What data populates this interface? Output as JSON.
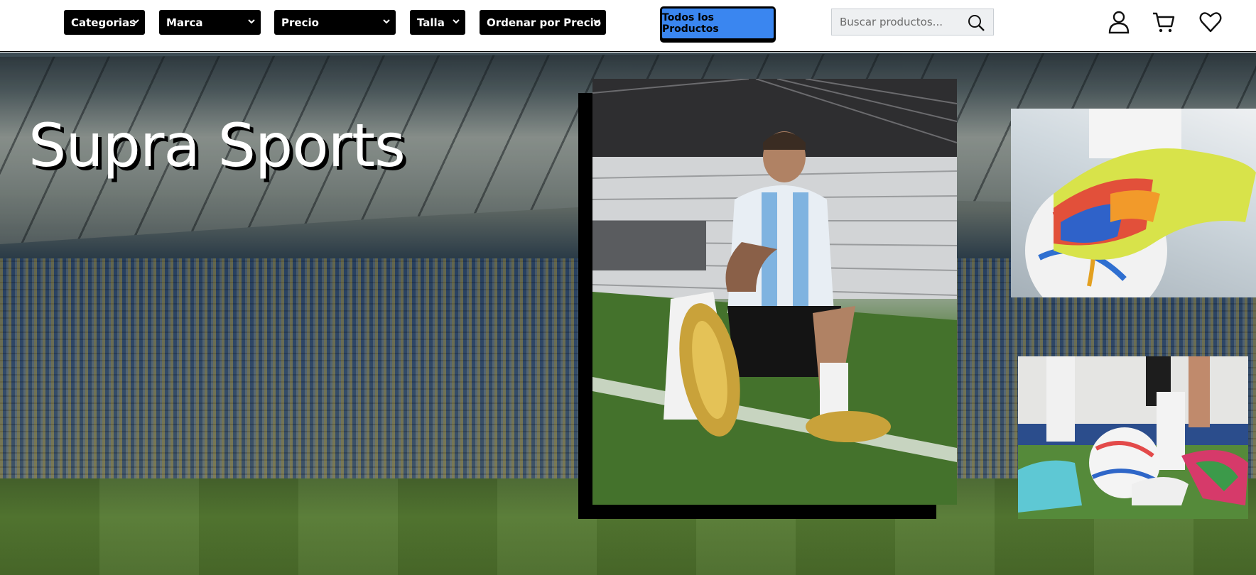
{
  "navbar": {
    "filters": [
      {
        "label": "Categorias"
      },
      {
        "label": "Marca"
      },
      {
        "label": "Precio"
      },
      {
        "label": "Talla"
      },
      {
        "label": "Ordenar por Precio"
      }
    ],
    "all_products_label": "Todos los Productos",
    "search": {
      "placeholder": "Buscar productos...",
      "value": ""
    },
    "icons": [
      "user-icon",
      "cart-icon",
      "heart-icon"
    ]
  },
  "hero": {
    "title": "Supra Sports"
  },
  "colors": {
    "accent": "#3a86f0",
    "navbar_bg": "#ffffff",
    "filter_bg": "#000000"
  }
}
